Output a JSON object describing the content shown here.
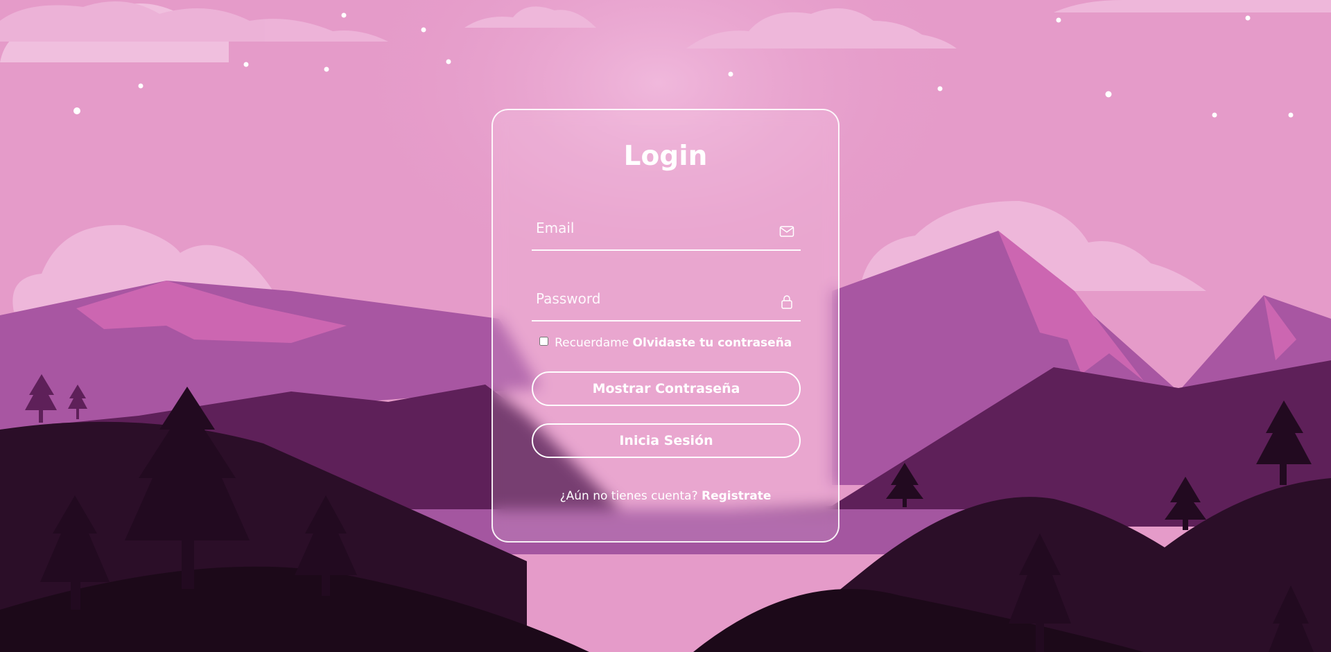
{
  "login": {
    "title": "Login",
    "email_placeholder": "Email",
    "password_placeholder": "Password",
    "remember_label": "Recuerdame",
    "forgot_link": "Olvidaste tu contraseña",
    "show_password_button": "Mostrar Contraseña",
    "submit_button": "Inicia Sesión",
    "no_account_text": "¿Aún no tienes cuenta?",
    "register_link": "Registrate"
  },
  "icons": {
    "email": "envelope-icon",
    "password": "lock-icon"
  },
  "colors": {
    "sky": "#e59bc9",
    "card_border": "#ffffff",
    "text": "#ffffff"
  }
}
